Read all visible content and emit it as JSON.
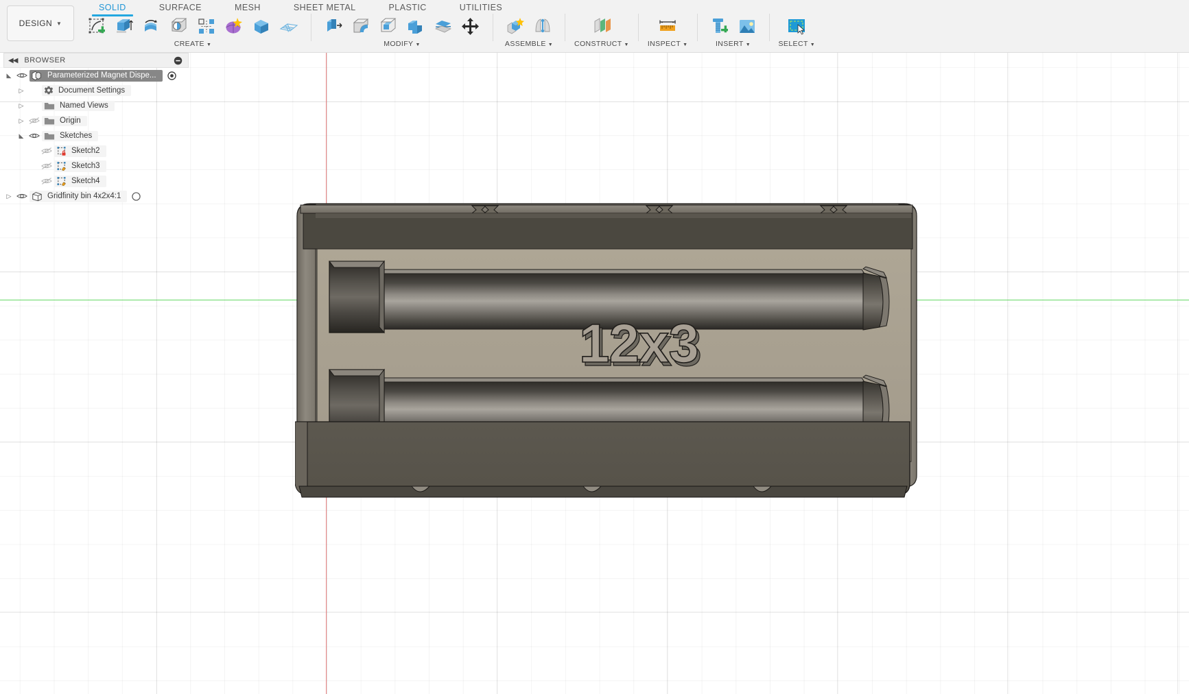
{
  "app": {
    "workspace_button": "DESIGN",
    "tabs": [
      {
        "label": "SOLID",
        "active": true
      },
      {
        "label": "SURFACE",
        "active": false
      },
      {
        "label": "MESH",
        "active": false
      },
      {
        "label": "SHEET METAL",
        "active": false
      },
      {
        "label": "PLASTIC",
        "active": false
      },
      {
        "label": "UTILITIES",
        "active": false
      }
    ]
  },
  "ribbon": {
    "groups": [
      {
        "name": "create",
        "label": "CREATE",
        "has_caret": true,
        "tools": [
          "create-sketch-icon",
          "extrude-icon",
          "revolve-icon",
          "hole-icon",
          "pattern-icon",
          "form-icon",
          "box-icon",
          "mesh-plane-icon"
        ]
      },
      {
        "name": "modify",
        "label": "MODIFY",
        "has_caret": true,
        "tools": [
          "press-pull-icon",
          "fillet-icon",
          "shell-icon",
          "combine-icon",
          "split-face-icon",
          "move-copy-icon"
        ]
      },
      {
        "name": "assemble",
        "label": "ASSEMBLE",
        "has_caret": true,
        "tools": [
          "new-component-icon",
          "joint-icon"
        ]
      },
      {
        "name": "construct",
        "label": "CONSTRUCT",
        "has_caret": true,
        "tools": [
          "offset-plane-icon"
        ]
      },
      {
        "name": "inspect",
        "label": "INSPECT",
        "has_caret": true,
        "tools": [
          "measure-icon"
        ]
      },
      {
        "name": "insert",
        "label": "INSERT",
        "has_caret": true,
        "tools": [
          "insert-mcmaster-icon",
          "insert-decal-icon"
        ]
      },
      {
        "name": "select",
        "label": "SELECT",
        "has_caret": true,
        "tools": [
          "select-window-icon"
        ]
      }
    ]
  },
  "browser": {
    "title": "BROWSER",
    "collapse_icon": "collapse-all-icon",
    "rewind_icon": "panel-collapse-icon",
    "tree": [
      {
        "label": "Parameterized Magnet Dispe...",
        "arrow": "expanded",
        "icon": "component-icon",
        "eye": "visible",
        "selected": true,
        "indent": 0,
        "endmark": "radio-target-icon"
      },
      {
        "label": "Document Settings",
        "arrow": "collapsed",
        "icon": "gear-icon",
        "eye": "none",
        "selected": false,
        "indent": 1,
        "endmark": ""
      },
      {
        "label": "Named Views",
        "arrow": "collapsed",
        "icon": "folder-icon",
        "eye": "none",
        "selected": false,
        "indent": 1,
        "endmark": ""
      },
      {
        "label": "Origin",
        "arrow": "collapsed",
        "icon": "folder-icon",
        "eye": "hidden",
        "selected": false,
        "indent": 1,
        "endmark": ""
      },
      {
        "label": "Sketches",
        "arrow": "expanded",
        "icon": "folder-icon",
        "eye": "visible",
        "selected": false,
        "indent": 1,
        "endmark": ""
      },
      {
        "label": "Sketch2",
        "arrow": "blank",
        "icon": "sketch-locked-icon",
        "eye": "hidden",
        "selected": false,
        "indent": 2,
        "endmark": ""
      },
      {
        "label": "Sketch3",
        "arrow": "blank",
        "icon": "sketch-icon",
        "eye": "hidden",
        "selected": false,
        "indent": 2,
        "endmark": ""
      },
      {
        "label": "Sketch4",
        "arrow": "blank",
        "icon": "sketch-icon",
        "eye": "hidden",
        "selected": false,
        "indent": 2,
        "endmark": ""
      },
      {
        "label": "Gridfinity bin 4x2x4:1",
        "arrow": "collapsed",
        "icon": "body-icon",
        "eye": "visible",
        "selected": false,
        "indent": 0,
        "endmark": "circle-icon"
      }
    ]
  },
  "canvas": {
    "model_label": "12x3",
    "axis_x_color": "#4ad14a",
    "axis_y_color": "#f08a8a",
    "body_face_color": "#a9a195",
    "body_rim_color": "#55514a",
    "body_channel_color": "#3c3934",
    "grid_color": "#e8e8e8",
    "background_color": "#ffffff"
  }
}
